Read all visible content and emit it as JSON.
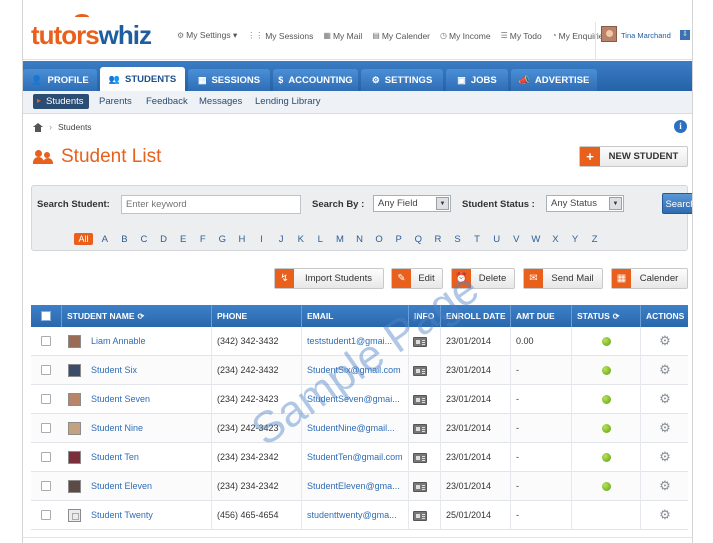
{
  "brand": {
    "part1": "tutors",
    "part2": "whiz"
  },
  "toplinks": [
    {
      "icon": "⚙",
      "label": "My Settings ▾"
    },
    {
      "icon": "⋮⋮",
      "label": "My Sessions"
    },
    {
      "icon": "▦",
      "label": "My Mail"
    },
    {
      "icon": "▤",
      "label": "My Calender"
    },
    {
      "icon": "◷",
      "label": "My Income"
    },
    {
      "icon": "☰",
      "label": "My Todo"
    },
    {
      "icon": "◔",
      "label": "My Enquiries"
    }
  ],
  "user": {
    "name": "Tina Marchand",
    "menu_icon": "⇩"
  },
  "nav": [
    {
      "icon": "👤",
      "label": "PROFILE"
    },
    {
      "icon": "👥",
      "label": "STUDENTS"
    },
    {
      "icon": "▦",
      "label": "SESSIONS"
    },
    {
      "icon": "$",
      "label": "ACCOUNTING"
    },
    {
      "icon": "⚙",
      "label": "SETTINGS"
    },
    {
      "icon": "▣",
      "label": "JOBS"
    },
    {
      "icon": "📣",
      "label": "ADVERTISE"
    }
  ],
  "subnav": [
    "Students",
    "Parents",
    "Feedback",
    "Messages",
    "Lending Library"
  ],
  "breadcrumb": {
    "current": "Students",
    "separator": "›"
  },
  "info_icon": "i",
  "page_title": "Student List",
  "new_student_label": "NEW STUDENT",
  "new_student_icon": "+",
  "search": {
    "student_label": "Search Student:",
    "keyword_placeholder": "Enter keyword",
    "search_by_label": "Search By :",
    "search_by_value": "Any Field",
    "status_label": "Student Status :",
    "status_value": "Any Status",
    "button_label": "Search",
    "letters": [
      "All",
      "A",
      "B",
      "C",
      "D",
      "E",
      "F",
      "G",
      "H",
      "I",
      "J",
      "K",
      "L",
      "M",
      "N",
      "O",
      "P",
      "Q",
      "R",
      "S",
      "T",
      "U",
      "V",
      "W",
      "X",
      "Y",
      "Z"
    ]
  },
  "actions": [
    {
      "icon": "↯",
      "label": "Import Students"
    },
    {
      "icon": "✎",
      "label": "Edit"
    },
    {
      "icon": "⏰",
      "label": "Delete"
    },
    {
      "icon": "✉",
      "label": "Send Mail"
    },
    {
      "icon": "▦",
      "label": "Calender"
    }
  ],
  "table": {
    "headers": [
      "STUDENT NAME",
      "PHONE",
      "EMAIL",
      "INFO",
      "ENROLL DATE",
      "AMT DUE",
      "STATUS",
      "ACTIONS"
    ],
    "sort_icon": "⟳",
    "rows": [
      {
        "name": "Liam Annable",
        "phone": "(342) 342-3432",
        "email": "teststudent1@gmai...",
        "date": "23/01/2014",
        "amt": "0.00"
      },
      {
        "name": "Student Six",
        "phone": "(234) 242-3432",
        "email": "StudentSix@gmail.com",
        "date": "23/01/2014",
        "amt": "-"
      },
      {
        "name": "Student Seven",
        "phone": "(234) 242-3423",
        "email": "StudentSeven@gmai...",
        "date": "23/01/2014",
        "amt": "-"
      },
      {
        "name": "Student Nine",
        "phone": "(234) 242-3423",
        "email": "StudentNine@gmail...",
        "date": "23/01/2014",
        "amt": "-"
      },
      {
        "name": "Student Ten",
        "phone": "(234) 234-2342",
        "email": "StudentTen@gmail.com",
        "date": "23/01/2014",
        "amt": "-"
      },
      {
        "name": "Student Eleven",
        "phone": "(234) 234-2342",
        "email": "StudentEleven@gma...",
        "date": "23/01/2014",
        "amt": "-"
      },
      {
        "name": "Student Twenty",
        "phone": "(456) 465-4654",
        "email": "studenttwenty@gma...",
        "date": "25/01/2014",
        "amt": "-"
      }
    ]
  },
  "watermark": "Sample Page",
  "colors": {
    "accent": "#e8601c",
    "brand_blue": "#1e5d9e",
    "nav_blue": "#2f6db5",
    "status_active": "#5a9e12"
  }
}
